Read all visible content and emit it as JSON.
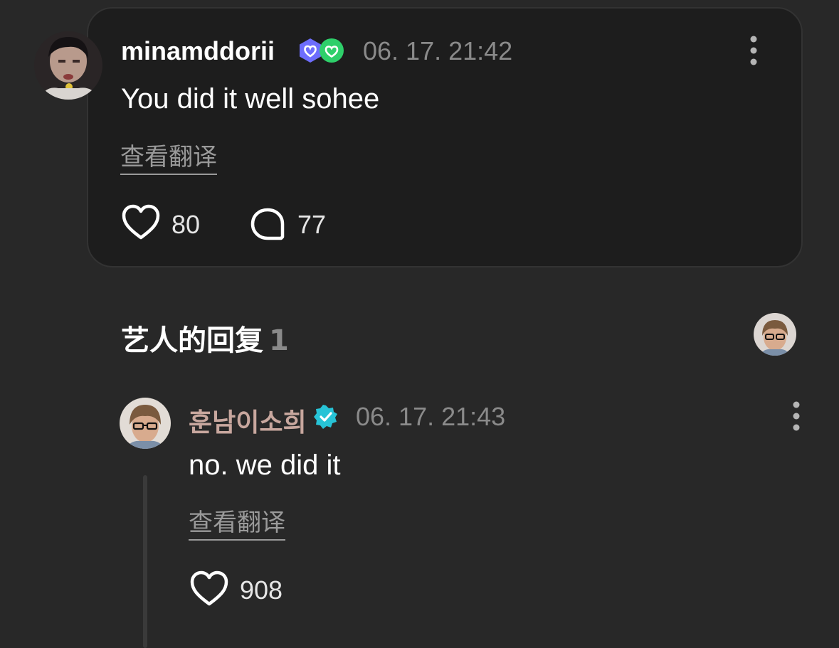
{
  "comment": {
    "username": "minamddorii",
    "timestamp": "06. 17. 21:42",
    "text": "You did it well sohee",
    "translate_label": "查看翻译",
    "like_count": "80",
    "reply_count": "77",
    "badges": [
      "membership-badge-icon",
      "verified-fan-badge-icon"
    ]
  },
  "artist_replies": {
    "title": "艺人的回复",
    "count": "1"
  },
  "reply": {
    "username": "훈남이소희",
    "timestamp": "06. 17. 21:43",
    "text": "no. we did it",
    "translate_label": "查看翻译",
    "like_count": "908",
    "badge": "artist-verified-badge-icon"
  },
  "colors": {
    "background": "#282828",
    "card": "#1d1d1d",
    "artist_name": "#c8a79e",
    "verified": "#27c3d6",
    "membership": "#6d6dfd",
    "fan_badge": "#2ecf6a",
    "muted": "#8a8a8a"
  }
}
